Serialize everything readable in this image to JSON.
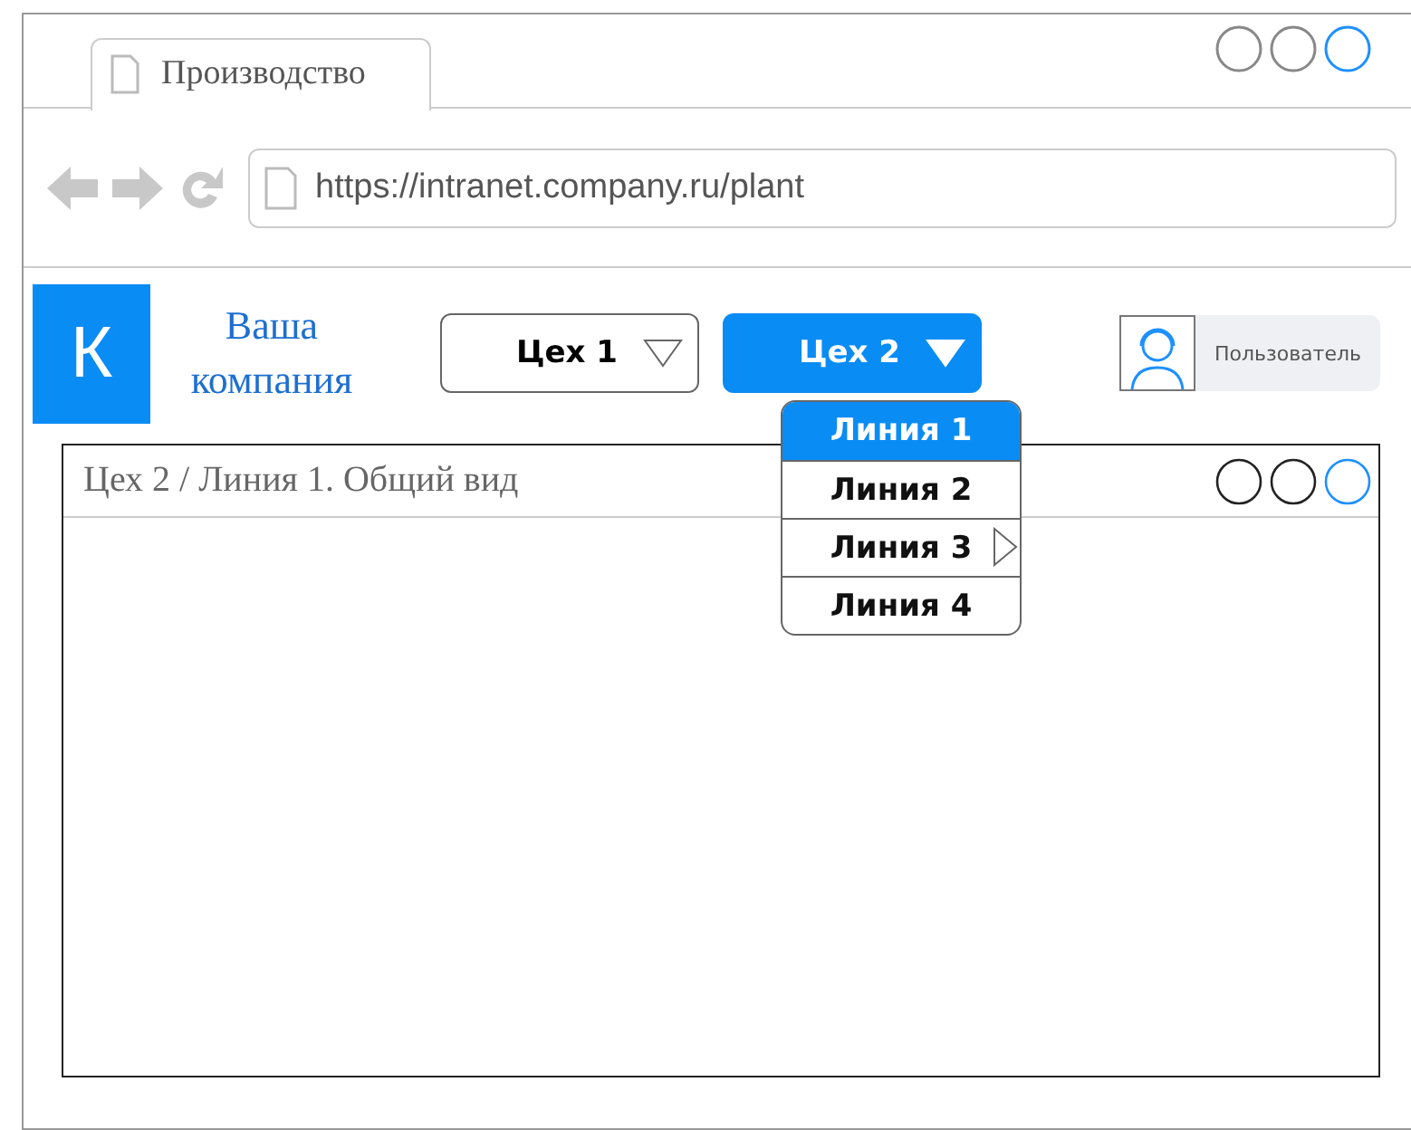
{
  "browser": {
    "tab_title": "Производство",
    "url": "https://intranet.company.ru/plant"
  },
  "header": {
    "logo_letter": "К",
    "company_name": "Ваша компания",
    "user_label": "Пользователь"
  },
  "workshops": [
    {
      "label": "Цех 1",
      "selected": false
    },
    {
      "label": "Цех 2",
      "selected": true
    }
  ],
  "lines_menu": [
    {
      "label": "Линия 1",
      "selected": true,
      "has_submenu": false
    },
    {
      "label": "Линия 2",
      "selected": false,
      "has_submenu": false
    },
    {
      "label": "Линия 3",
      "selected": false,
      "has_submenu": true
    },
    {
      "label": "Линия 4",
      "selected": false,
      "has_submenu": false
    }
  ],
  "panel": {
    "title": "Цех 2 / Линия 1. Общий вид"
  }
}
